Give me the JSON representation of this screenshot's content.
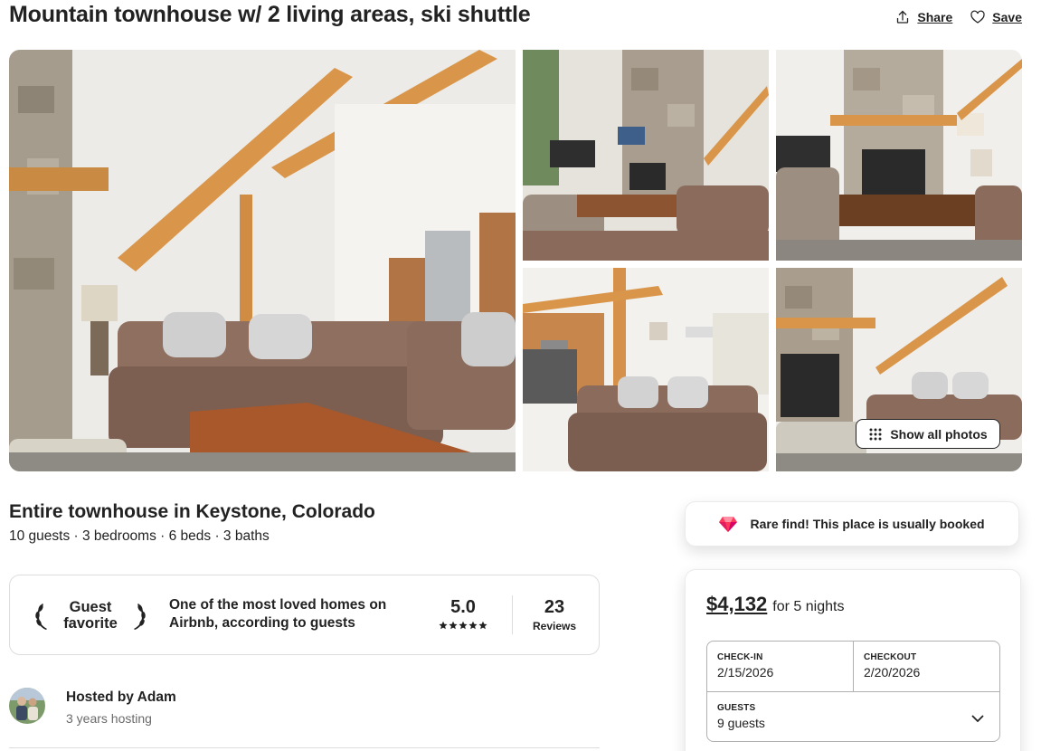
{
  "listing": {
    "title": "Mountain townhouse w/ 2 living areas, ski shuttle",
    "share_label": "Share",
    "save_label": "Save",
    "share_icon": "share-icon",
    "save_icon": "heart-icon"
  },
  "gallery": {
    "photos": [
      {
        "name": "living-room-staircase-photo"
      },
      {
        "name": "living-room-fireplace-photo"
      },
      {
        "name": "stone-fireplace-photo"
      },
      {
        "name": "kitchen-sofa-photo"
      },
      {
        "name": "fireplace-sofa-photo"
      }
    ],
    "show_all_label": "Show all photos",
    "show_all_icon": "grid-dots-icon"
  },
  "overview": {
    "subtitle": "Entire townhouse in Keystone, Colorado",
    "details": "10 guests · 3 bedrooms · 6 beds · 3 baths"
  },
  "guest_favorite": {
    "badge_line1": "Guest",
    "badge_line2": "favorite",
    "description": "One of the most loved homes on Airbnb, according to guests",
    "rating": "5.0",
    "stars": 5,
    "reviews_count": "23",
    "reviews_label": "Reviews",
    "laurel_icon": "laurel-icon",
    "star_icon": "star-icon"
  },
  "host": {
    "name": "Hosted by Adam",
    "hosting": "3 years hosting"
  },
  "rare_find": {
    "text": "Rare find! This place is usually booked",
    "icon": "diamond-icon",
    "color": "#e31c5f"
  },
  "booking": {
    "price": "$4,132",
    "price_for": "for 5 nights",
    "checkin_label": "CHECK-IN",
    "checkin_value": "2/15/2026",
    "checkout_label": "CHECKOUT",
    "checkout_value": "2/20/2026",
    "guests_label": "GUESTS",
    "guests_value": "9 guests",
    "dropdown_icon": "chevron-down-icon"
  }
}
